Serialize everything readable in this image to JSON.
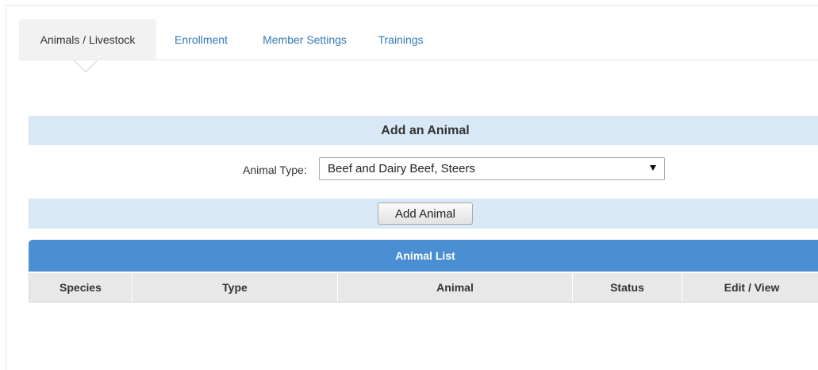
{
  "tabs": [
    {
      "label": "Animals / Livestock",
      "active": true
    },
    {
      "label": "Enrollment",
      "active": false
    },
    {
      "label": "Member Settings",
      "active": false
    },
    {
      "label": "Trainings",
      "active": false
    }
  ],
  "add_animal": {
    "title": "Add an Animal",
    "type_label": "Animal Type:",
    "selected_type": "Beef and Dairy Beef, Steers",
    "button_label": "Add Animal"
  },
  "animal_list": {
    "title": "Animal List",
    "columns": [
      "Species",
      "Type",
      "Animal",
      "Status",
      "Edit / View"
    ],
    "rows": []
  },
  "colors": {
    "section_bar": "#d9e8f6",
    "list_header": "#4a8fd1",
    "link": "#337ab7"
  }
}
